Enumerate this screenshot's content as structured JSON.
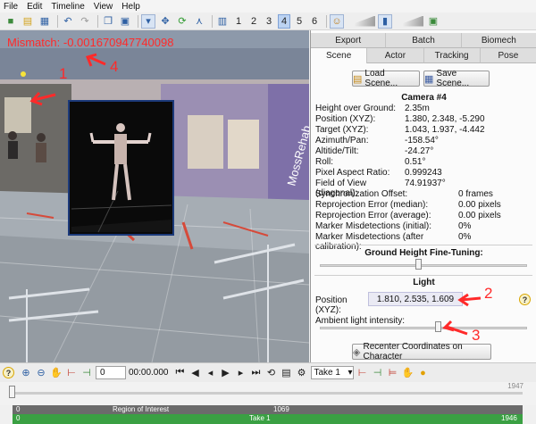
{
  "menu": [
    "File",
    "Edit",
    "Timeline",
    "View",
    "Help"
  ],
  "toolbar": {
    "numbers": [
      "1",
      "2",
      "3",
      "4",
      "5",
      "6"
    ],
    "active_number": "4"
  },
  "viewport": {
    "mismatch_label": "Mismatch:",
    "mismatch_value": "-0.001670947740098",
    "annotations": [
      "1",
      "4"
    ],
    "wall_text": "MossRehab"
  },
  "panel": {
    "tabs_top": [
      "Export",
      "Batch",
      "Biomech"
    ],
    "tabs_bottom": [
      "Scene",
      "Actor",
      "Tracking",
      "Pose"
    ],
    "selected_tab": "Scene",
    "load_scene": "Load Scene...",
    "save_scene": "Save Scene...",
    "camera_title": "Camera #4",
    "props": [
      {
        "k": "Height over Ground:",
        "v": "2.35m"
      },
      {
        "k": "Position (XYZ):",
        "v": "1.380, 2.348, -5.290"
      },
      {
        "k": "Target (XYZ):",
        "v": "1.043, 1.937, -4.442"
      },
      {
        "k": "Azimuth/Pan:",
        "v": "-158.54°"
      },
      {
        "k": "Altitide/Tilt:",
        "v": "-24.27°"
      },
      {
        "k": "Roll:",
        "v": "0.51°"
      },
      {
        "k": "Pixel Aspect Ratio:",
        "v": "0.999243"
      },
      {
        "k": "Field of View (diagonal):",
        "v": "74.91937°"
      }
    ],
    "props2": [
      {
        "k": "Synchronization Offset:",
        "v": "0 frames"
      },
      {
        "k": "Reprojection Error (median):",
        "v": "0.00 pixels"
      },
      {
        "k": "Reprojection Error (average):",
        "v": "0.00 pixels"
      },
      {
        "k": "Marker Misdetections (initial):",
        "v": "0%"
      },
      {
        "k": "Marker Misdetections (after calibration):",
        "v": "0%"
      }
    ],
    "ground_title": "Ground Height Fine-Tuning:",
    "ground_level": 0.5,
    "light_title": "Light",
    "light_pos_label": "Position (XYZ):",
    "light_pos_value": "1.810, 2.535, 1.609",
    "ambient_label": "Ambient light intensity:",
    "ambient_level": 0.5,
    "recenter": "Recenter Coordinates on Character",
    "annotations": [
      "2",
      "3"
    ],
    "help": "?"
  },
  "bottom": {
    "help": "?",
    "frame_value": "0",
    "time_value": "00:00.000",
    "take_value": "Take 1"
  },
  "timeline": {
    "max": "1947",
    "roi_start": "0",
    "roi_label": "Region of Interest",
    "roi_end": "1069",
    "take_start": "0",
    "take_label": "Take 1",
    "take_end": "1946"
  },
  "colors": {
    "accent": "#ff2a2a",
    "take_bar": "#3aa043",
    "roi_bar": "#6b6b6b"
  }
}
